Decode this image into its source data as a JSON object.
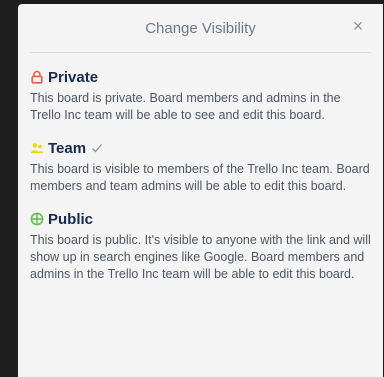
{
  "popover": {
    "title": "Change Visibility",
    "close_icon": "×"
  },
  "options": [
    {
      "name": "Private",
      "icon": "lock-icon",
      "color": "#eb5a46",
      "selected": false,
      "description": "This board is private. Board members and admins in the Trello Inc team will be able to see and edit this board."
    },
    {
      "name": "Team",
      "icon": "team-icon",
      "color": "#f2d600",
      "selected": true,
      "description": "This board is visible to members of the Trello Inc team. Board members and team admins will be able to edit this board."
    },
    {
      "name": "Public",
      "icon": "globe-icon",
      "color": "#61bd4f",
      "selected": false,
      "description": "This board is public. It's visible to anyone with the link and will show up in search engines like Google. Board members and admins in the Trello Inc team will be able to edit this board."
    }
  ]
}
